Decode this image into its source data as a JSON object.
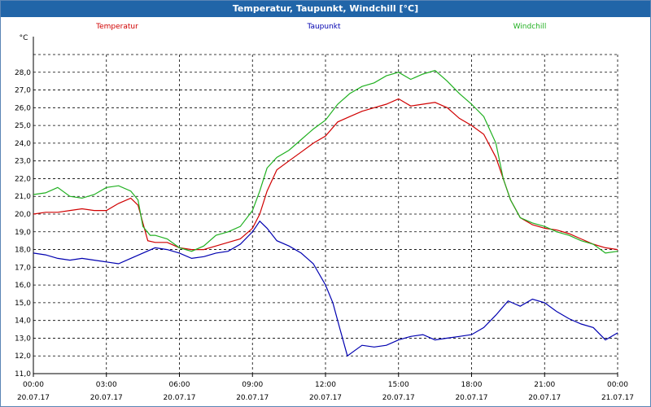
{
  "window": {
    "title": "Temperatur, Taupunkt, Windchill [°C]"
  },
  "chart_data": {
    "type": "line",
    "title": "Temperatur, Taupunkt, Windchill [°C]",
    "ylabel": "°C",
    "ylim": [
      11.0,
      29.0
    ],
    "xlim_hours": [
      0,
      24
    ],
    "grid": true,
    "y_ticks": [
      "11,0",
      "12,0",
      "13,0",
      "14,0",
      "15,0",
      "16,0",
      "17,0",
      "18,0",
      "19,0",
      "20,0",
      "21,0",
      "22,0",
      "23,0",
      "24,0",
      "25,0",
      "26,0",
      "27,0",
      "28,0"
    ],
    "x_ticks": [
      {
        "time": "00:00",
        "date": "20.07.17"
      },
      {
        "time": "03:00",
        "date": "20.07.17"
      },
      {
        "time": "06:00",
        "date": "20.07.17"
      },
      {
        "time": "09:00",
        "date": "20.07.17"
      },
      {
        "time": "12:00",
        "date": "20.07.17"
      },
      {
        "time": "15:00",
        "date": "20.07.17"
      },
      {
        "time": "18:00",
        "date": "20.07.17"
      },
      {
        "time": "21:00",
        "date": "20.07.17"
      },
      {
        "time": "00:00",
        "date": "21.07.17"
      }
    ],
    "series": [
      {
        "name": "Temperatur",
        "color": "#d00000",
        "points": [
          [
            0,
            20.0
          ],
          [
            0.5,
            20.1
          ],
          [
            1,
            20.1
          ],
          [
            1.5,
            20.2
          ],
          [
            2,
            20.3
          ],
          [
            2.5,
            20.2
          ],
          [
            3,
            20.2
          ],
          [
            3.5,
            20.6
          ],
          [
            4,
            20.9
          ],
          [
            4.3,
            20.5
          ],
          [
            4.5,
            19.5
          ],
          [
            4.7,
            18.5
          ],
          [
            5,
            18.4
          ],
          [
            5.5,
            18.4
          ],
          [
            6,
            18.1
          ],
          [
            6.5,
            18.0
          ],
          [
            7,
            18.0
          ],
          [
            7.5,
            18.2
          ],
          [
            8,
            18.4
          ],
          [
            8.5,
            18.6
          ],
          [
            9,
            19.2
          ],
          [
            9.3,
            20.0
          ],
          [
            9.6,
            21.3
          ],
          [
            10,
            22.5
          ],
          [
            10.5,
            23.0
          ],
          [
            11,
            23.5
          ],
          [
            11.5,
            24.0
          ],
          [
            12,
            24.4
          ],
          [
            12.5,
            25.2
          ],
          [
            13,
            25.5
          ],
          [
            13.5,
            25.8
          ],
          [
            14,
            26.0
          ],
          [
            14.5,
            26.2
          ],
          [
            15,
            26.5
          ],
          [
            15.5,
            26.1
          ],
          [
            16,
            26.2
          ],
          [
            16.5,
            26.3
          ],
          [
            17,
            26.0
          ],
          [
            17.5,
            25.4
          ],
          [
            18,
            25.0
          ],
          [
            18.5,
            24.5
          ],
          [
            19,
            23.2
          ],
          [
            19.3,
            22.0
          ],
          [
            19.6,
            20.8
          ],
          [
            20,
            19.8
          ],
          [
            20.5,
            19.4
          ],
          [
            21,
            19.2
          ],
          [
            21.5,
            19.1
          ],
          [
            22,
            18.9
          ],
          [
            22.5,
            18.6
          ],
          [
            23,
            18.3
          ],
          [
            23.5,
            18.1
          ],
          [
            24,
            18.0
          ]
        ]
      },
      {
        "name": "Taupunkt",
        "color": "#0000b0",
        "points": [
          [
            0,
            17.8
          ],
          [
            0.5,
            17.7
          ],
          [
            1,
            17.5
          ],
          [
            1.5,
            17.4
          ],
          [
            2,
            17.5
          ],
          [
            2.5,
            17.4
          ],
          [
            3,
            17.3
          ],
          [
            3.5,
            17.2
          ],
          [
            4,
            17.5
          ],
          [
            4.5,
            17.8
          ],
          [
            5,
            18.1
          ],
          [
            5.5,
            18.0
          ],
          [
            6,
            17.8
          ],
          [
            6.5,
            17.5
          ],
          [
            7,
            17.6
          ],
          [
            7.5,
            17.8
          ],
          [
            8,
            17.9
          ],
          [
            8.5,
            18.3
          ],
          [
            9,
            19.0
          ],
          [
            9.3,
            19.6
          ],
          [
            9.6,
            19.2
          ],
          [
            10,
            18.5
          ],
          [
            10.5,
            18.2
          ],
          [
            11,
            17.8
          ],
          [
            11.5,
            17.2
          ],
          [
            12,
            16.0
          ],
          [
            12.3,
            15.0
          ],
          [
            12.6,
            13.5
          ],
          [
            12.9,
            12.0
          ],
          [
            13.2,
            12.3
          ],
          [
            13.5,
            12.6
          ],
          [
            14,
            12.5
          ],
          [
            14.5,
            12.6
          ],
          [
            15,
            12.9
          ],
          [
            15.5,
            13.1
          ],
          [
            16,
            13.2
          ],
          [
            16.5,
            12.9
          ],
          [
            17,
            13.0
          ],
          [
            17.5,
            13.1
          ],
          [
            18,
            13.2
          ],
          [
            18.5,
            13.6
          ],
          [
            19,
            14.3
          ],
          [
            19.5,
            15.1
          ],
          [
            20,
            14.8
          ],
          [
            20.5,
            15.2
          ],
          [
            21,
            15.0
          ],
          [
            21.5,
            14.5
          ],
          [
            22,
            14.1
          ],
          [
            22.5,
            13.8
          ],
          [
            23,
            13.6
          ],
          [
            23.5,
            12.9
          ],
          [
            24,
            13.3
          ]
        ]
      },
      {
        "name": "Windchill",
        "color": "#20b020",
        "points": [
          [
            0,
            21.1
          ],
          [
            0.5,
            21.2
          ],
          [
            1,
            21.5
          ],
          [
            1.5,
            21.0
          ],
          [
            2,
            20.9
          ],
          [
            2.5,
            21.1
          ],
          [
            3,
            21.5
          ],
          [
            3.5,
            21.6
          ],
          [
            4,
            21.3
          ],
          [
            4.3,
            20.8
          ],
          [
            4.5,
            19.3
          ],
          [
            4.8,
            18.8
          ],
          [
            5,
            18.8
          ],
          [
            5.5,
            18.6
          ],
          [
            6,
            18.1
          ],
          [
            6.5,
            17.9
          ],
          [
            7,
            18.2
          ],
          [
            7.5,
            18.8
          ],
          [
            8,
            19.0
          ],
          [
            8.5,
            19.3
          ],
          [
            9,
            20.2
          ],
          [
            9.3,
            21.3
          ],
          [
            9.6,
            22.6
          ],
          [
            10,
            23.2
          ],
          [
            10.5,
            23.6
          ],
          [
            11,
            24.2
          ],
          [
            11.5,
            24.8
          ],
          [
            12,
            25.3
          ],
          [
            12.5,
            26.2
          ],
          [
            13,
            26.8
          ],
          [
            13.5,
            27.2
          ],
          [
            14,
            27.4
          ],
          [
            14.5,
            27.8
          ],
          [
            15,
            28.0
          ],
          [
            15.5,
            27.6
          ],
          [
            16,
            27.9
          ],
          [
            16.5,
            28.1
          ],
          [
            17,
            27.5
          ],
          [
            17.5,
            26.8
          ],
          [
            18,
            26.2
          ],
          [
            18.5,
            25.5
          ],
          [
            19,
            24.0
          ],
          [
            19.3,
            22.0
          ],
          [
            19.6,
            20.8
          ],
          [
            20,
            19.8
          ],
          [
            20.5,
            19.5
          ],
          [
            21,
            19.3
          ],
          [
            21.5,
            19.0
          ],
          [
            22,
            18.8
          ],
          [
            22.5,
            18.5
          ],
          [
            23,
            18.3
          ],
          [
            23.5,
            17.8
          ],
          [
            24,
            17.9
          ]
        ]
      }
    ]
  }
}
